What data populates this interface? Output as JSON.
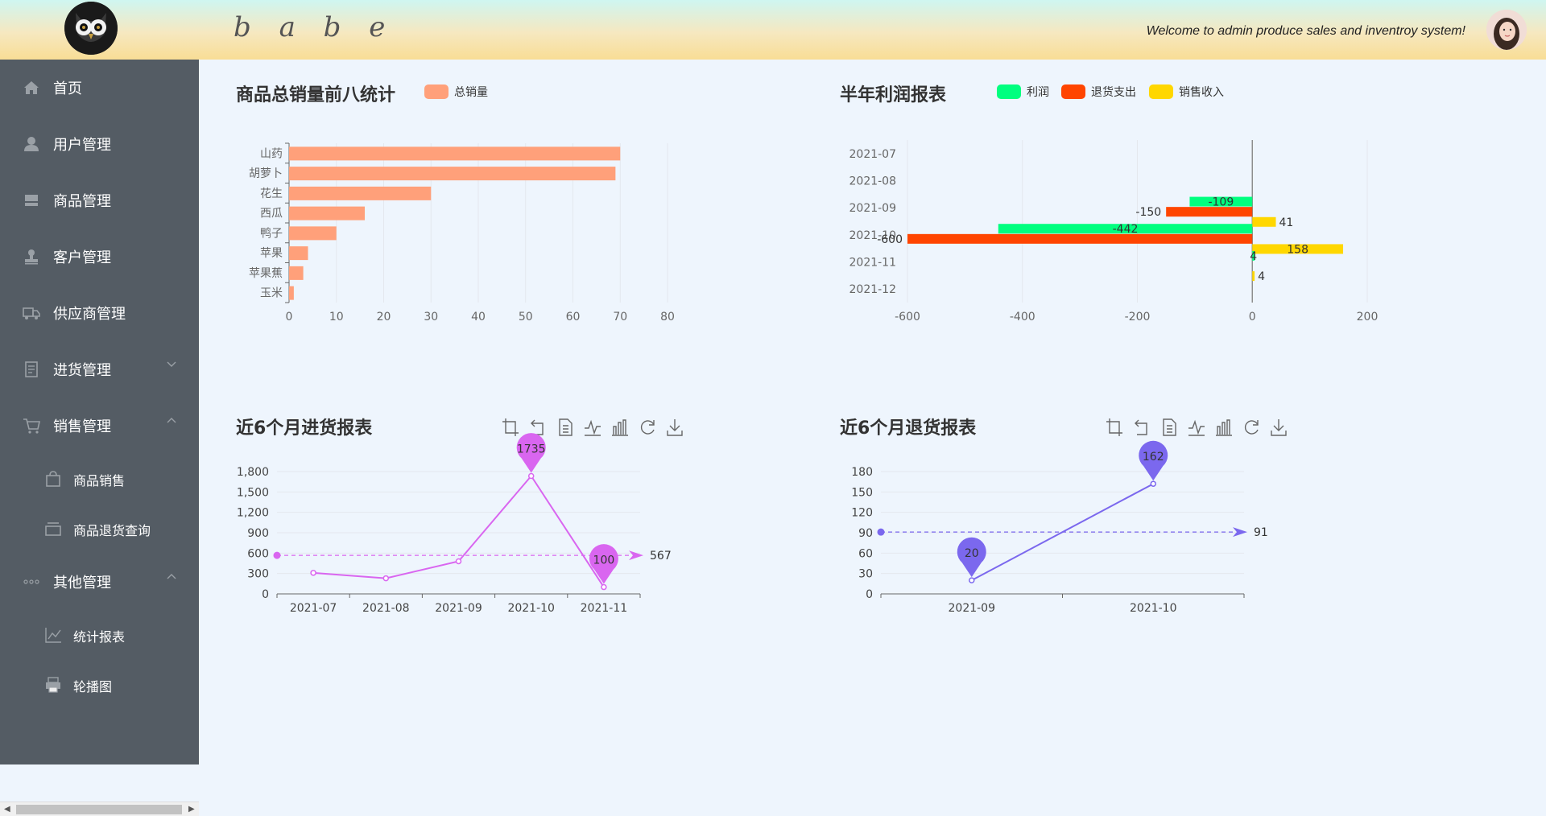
{
  "header": {
    "brand": "b a b e",
    "welcome": "Welcome to admin produce sales and inventroy system!"
  },
  "sidebar": {
    "items": [
      {
        "label": "首页",
        "icon": "home-icon"
      },
      {
        "label": "用户管理",
        "icon": "user-icon"
      },
      {
        "label": "商品管理",
        "icon": "inbox-icon"
      },
      {
        "label": "客户管理",
        "icon": "stamp-icon"
      },
      {
        "label": "供应商管理",
        "icon": "truck-icon"
      },
      {
        "label": "进货管理",
        "icon": "document-icon",
        "expanded": false
      },
      {
        "label": "销售管理",
        "icon": "cart-icon",
        "expanded": true
      },
      {
        "label": "其他管理",
        "icon": "more-icon",
        "expanded": true
      }
    ],
    "sales_sub": [
      {
        "label": "商品销售",
        "icon": "shopping-bag-icon"
      },
      {
        "label": "商品退货查询",
        "icon": "box-icon"
      }
    ],
    "other_sub": [
      {
        "label": "统计报表",
        "icon": "line-chart-icon"
      },
      {
        "label": "轮播图",
        "icon": "printer-icon"
      }
    ]
  },
  "toolbox": {
    "icons": [
      "zoom-icon",
      "zoom-reset-icon",
      "data-view-icon",
      "line-switch-icon",
      "bar-switch-icon",
      "restore-icon",
      "download-icon"
    ]
  },
  "chart_data": [
    {
      "type": "bar",
      "orientation": "horizontal",
      "title": "商品总销量前八统计",
      "categories": [
        "山药",
        "胡萝卜",
        "花生",
        "西瓜",
        "鸭子",
        "苹果",
        "苹果蕉",
        "玉米"
      ],
      "series": [
        {
          "name": "总销量",
          "values": [
            70,
            69,
            30,
            16,
            10,
            4,
            3,
            1
          ],
          "color": "#ffa07a"
        }
      ],
      "xlim": [
        0,
        80
      ],
      "xticks": [
        "0",
        "10",
        "20",
        "30",
        "40",
        "50",
        "60",
        "70",
        "80"
      ],
      "grid": true,
      "legend": "top"
    },
    {
      "type": "bar",
      "orientation": "horizontal",
      "title": "半年利润报表",
      "categories": [
        "2021-07",
        "2021-08",
        "2021-09",
        "2021-10",
        "2021-11",
        "2021-12"
      ],
      "series": [
        {
          "name": "利润",
          "values": [
            null,
            null,
            -109,
            -442,
            4,
            null
          ],
          "labels": [
            "",
            "",
            "-109",
            "-442",
            "4",
            ""
          ],
          "color": "#00ff7f"
        },
        {
          "name": "退货支出",
          "values": [
            null,
            null,
            -150,
            -600,
            null,
            null
          ],
          "labels": [
            "",
            "",
            "-150",
            "-600",
            "",
            ""
          ],
          "color": "#ff4500"
        },
        {
          "name": "销售收入",
          "values": [
            null,
            null,
            41,
            158,
            4,
            null
          ],
          "labels": [
            "",
            "",
            "41",
            "158",
            "4",
            ""
          ],
          "color": "#ffd700"
        }
      ],
      "xlim": [
        -600,
        200
      ],
      "xticks": [
        "-600",
        "-400",
        "-200",
        "0",
        "200"
      ],
      "grid": true,
      "legend": "top"
    },
    {
      "type": "line",
      "title": "近6个月进货报表",
      "categories": [
        "2021-07",
        "2021-08",
        "2021-09",
        "2021-10",
        "2021-11"
      ],
      "series": [
        {
          "values": [
            310,
            230,
            480,
            1735,
            100
          ],
          "color": "#d966f0"
        }
      ],
      "ylim": [
        0,
        1800
      ],
      "yticks": [
        "0",
        "300",
        "600",
        "900",
        "1,200",
        "1,500",
        "1,800"
      ],
      "mark_points": [
        {
          "label": "1735",
          "index": 3,
          "value": 1735
        },
        {
          "label": "100",
          "index": 4,
          "value": 100
        }
      ],
      "average": {
        "value": 567,
        "label": "567"
      },
      "grid": true
    },
    {
      "type": "line",
      "title": "近6个月退货报表",
      "categories": [
        "2021-09",
        "2021-10"
      ],
      "series": [
        {
          "values": [
            20,
            162
          ],
          "color": "#7b68ee"
        }
      ],
      "ylim": [
        0,
        180
      ],
      "yticks": [
        "0",
        "30",
        "60",
        "90",
        "120",
        "150",
        "180"
      ],
      "mark_points": [
        {
          "label": "162",
          "index": 1,
          "value": 162
        },
        {
          "label": "20",
          "index": 0,
          "value": 20
        }
      ],
      "average": {
        "value": 91,
        "label": "91"
      },
      "grid": true
    }
  ]
}
